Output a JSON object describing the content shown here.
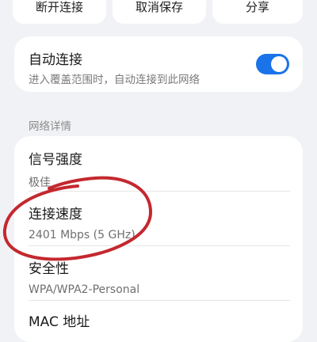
{
  "top_buttons": {
    "disconnect": "断开连接",
    "cancel_save": "取消保存",
    "share": "分享"
  },
  "auto_connect": {
    "title": "自动连接",
    "subtitle": "进入覆盖范围时，自动连接到此网络",
    "enabled": true,
    "accent_color": "#1a73e8"
  },
  "section": {
    "title": "网络详情"
  },
  "details": [
    {
      "label": "信号强度",
      "value": "极佳"
    },
    {
      "label": "连接速度",
      "value": "2401 Mbps (5 GHz)"
    },
    {
      "label": "安全性",
      "value": "WPA/WPA2-Personal"
    },
    {
      "label": "MAC 地址",
      "value": ""
    }
  ],
  "annotation": {
    "color": "#c4282f"
  }
}
